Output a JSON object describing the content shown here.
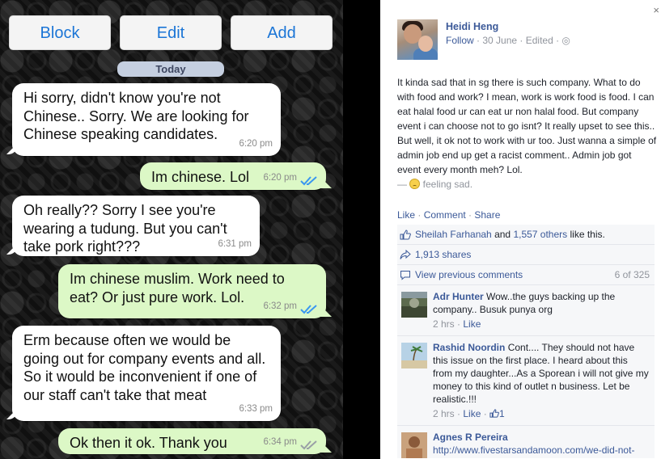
{
  "chat": {
    "buttons": {
      "block": "Block",
      "edit": "Edit",
      "add": "Add"
    },
    "date_badge": "Today",
    "messages": [
      {
        "direction": "in",
        "text": "Hi sorry, didn't know you're not Chinese.. Sorry. We are looking for Chinese speaking candidates.",
        "time": "6:20 pm"
      },
      {
        "direction": "out",
        "text": "Im chinese. Lol",
        "time": "6:20 pm"
      },
      {
        "direction": "in",
        "text": "Oh really?? Sorry I see you're wearing a tudung. But you can't take pork right???",
        "time": "6:31 pm"
      },
      {
        "direction": "out",
        "text": "Im chinese muslim. Work need to eat? Or just pure work. Lol.",
        "time": "6:32 pm"
      },
      {
        "direction": "in",
        "text": "Erm because often we would be going out for company events and all. So it would be inconvenient if one of our staff can't take that meat",
        "time": "6:33 pm"
      },
      {
        "direction": "out",
        "text": "Ok then it ok. Thank you",
        "time": "6:34 pm"
      }
    ],
    "tick_color": "#3a97f0",
    "tick_grey": "#9aa0a6"
  },
  "fb": {
    "author": "Heidi Heng",
    "follow": "Follow",
    "meta_rest": " · 30 June · Edited · ",
    "globe": "◎",
    "close": "×",
    "post_text": "It kinda sad that in sg there is such company. What to do with food and work? I mean, work is work food is food. I can eat halal food ur can eat ur non halal food. But company event i can choose not to go isnt? It really upset to see this.. But well, it ok not to work with ur too. Just wanna a simple of admin job end up get a racist comment.. Admin job got event every month meh? Lol.",
    "feeling_dash": "— ",
    "feeling": " feeling sad.",
    "actions": {
      "like": "Like",
      "comment": "Comment",
      "share": "Share",
      "sep": " · "
    },
    "likes": {
      "name": "Sheilah Farhanah",
      "and": " and ",
      "others": "1,557 others",
      "tail": " like this."
    },
    "shares": "1,913 shares",
    "view_previous": "View previous comments",
    "count": "6 of 325",
    "comments": [
      {
        "name": "Adr Hunter",
        "text": "Wow..the guys backing up the company.. Busuk punya org",
        "time": "2 hrs",
        "like": "Like",
        "likes": ""
      },
      {
        "name": "Rashid Noordin",
        "text": "Cont.... They should not have this issue on the first place. I heard about this from my daughter...As a Sporean i will not give my money to this kind of outlet n business. Let be realistic.!!!",
        "time": "2 hrs",
        "like": "Like",
        "likes": "1"
      },
      {
        "name": "Agnes R Pereira",
        "text": "",
        "link": "http://www.fivestarsandamoon.com/we-did-not-",
        "time": "",
        "like": "",
        "likes": ""
      }
    ],
    "link_color": "#3b5998"
  }
}
